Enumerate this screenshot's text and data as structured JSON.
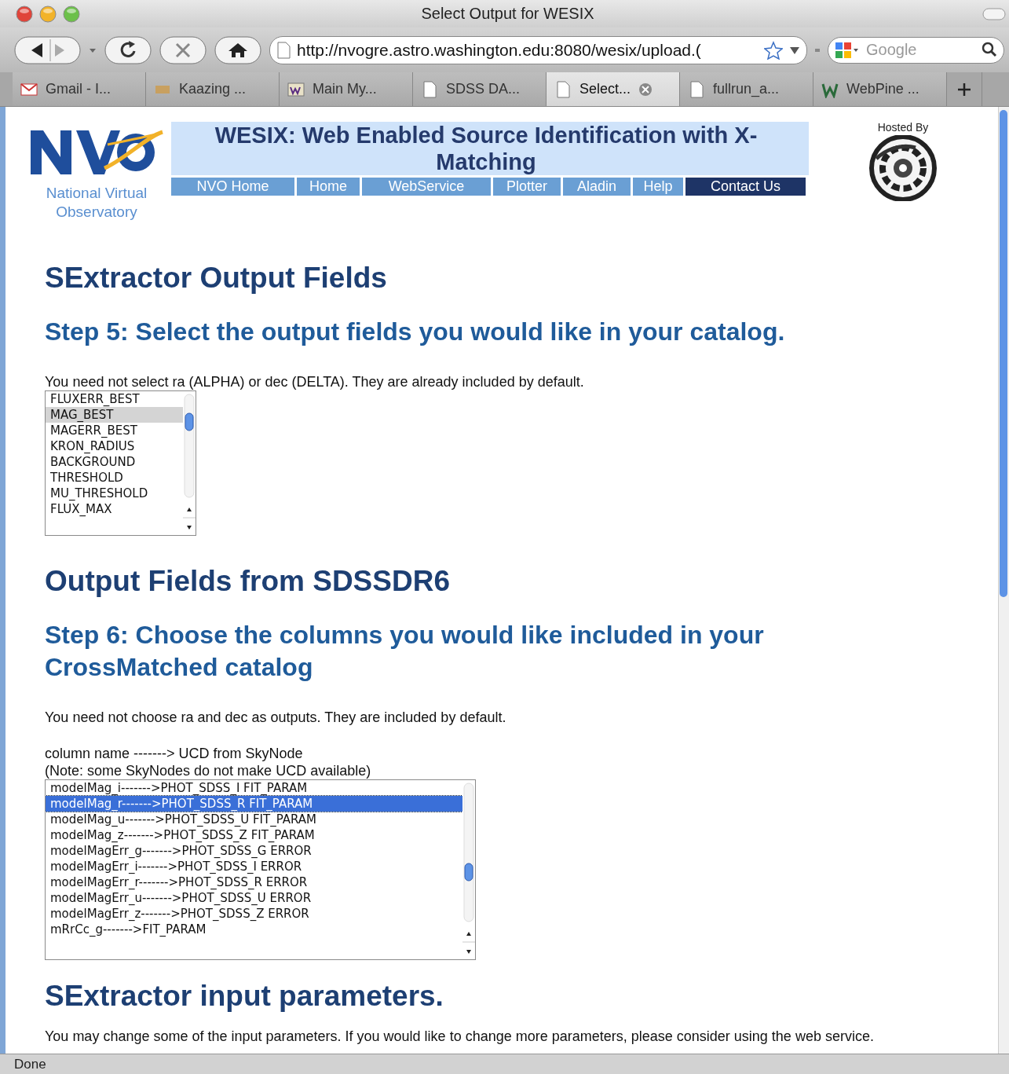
{
  "window": {
    "title": "Select Output for WESIX"
  },
  "toolbar": {
    "url": "http://nvogre.astro.washington.edu:8080/wesix/upload.(",
    "search": {
      "placeholder": "Google"
    }
  },
  "tabs": [
    {
      "label": "Gmail - I...",
      "selected": false,
      "kind": "mail"
    },
    {
      "label": "Kaazing ...",
      "selected": false,
      "kind": "site"
    },
    {
      "label": "Main My...",
      "selected": false,
      "kind": "uw"
    },
    {
      "label": "SDSS DA...",
      "selected": false,
      "kind": "page"
    },
    {
      "label": "Select...",
      "selected": true,
      "kind": "page"
    },
    {
      "label": "fullrun_a...",
      "selected": false,
      "kind": "page"
    },
    {
      "label": "WebPine ...",
      "selected": false,
      "kind": "w"
    }
  ],
  "header": {
    "logo_caption": "National Virtual Observatory",
    "title": "WESIX: Web Enabled Source Identification with X-Matching",
    "nav": [
      {
        "label": "NVO Home",
        "selected": false
      },
      {
        "label": "Home",
        "selected": false
      },
      {
        "label": "WebService",
        "selected": false
      },
      {
        "label": "Plotter",
        "selected": false
      },
      {
        "label": "Aladin",
        "selected": false
      },
      {
        "label": "Help",
        "selected": false
      },
      {
        "label": "Contact Us",
        "selected": true
      }
    ],
    "hosted_by": "Hosted By"
  },
  "content": [
    {
      "kind": "heading",
      "text": "SExtractor Output Fields"
    },
    {
      "kind": "step",
      "text": "Step 5: Select the output fields you would like in your catalog."
    },
    {
      "kind": "text",
      "text": "You need not select ra (ALPHA) or dec (DELTA). They are already included by default."
    },
    {
      "kind": "listbox",
      "focused": false,
      "options": [
        {
          "label": "FLUXERR_BEST",
          "selected": false
        },
        {
          "label": "MAG_BEST",
          "selected": true
        },
        {
          "label": "MAGERR_BEST",
          "selected": false
        },
        {
          "label": "KRON_RADIUS",
          "selected": false
        },
        {
          "label": "BACKGROUND",
          "selected": false
        },
        {
          "label": "THRESHOLD",
          "selected": false
        },
        {
          "label": "MU_THRESHOLD",
          "selected": false
        },
        {
          "label": "FLUX_MAX",
          "selected": false
        }
      ]
    },
    {
      "kind": "heading",
      "text": "Output Fields from SDSSDR6"
    },
    {
      "kind": "step",
      "text": "Step 6: Choose the columns you would like included in your CrossMatched catalog"
    },
    {
      "kind": "text",
      "text": "You need not choose ra and dec as outputs. They are included by default."
    },
    {
      "kind": "text",
      "text": "column name -------> UCD from SkyNode"
    },
    {
      "kind": "text",
      "text": "(Note: some SkyNodes do not make UCD available)"
    },
    {
      "kind": "listbox",
      "focused": true,
      "options": [
        {
          "label": "modelMag_i------->PHOT_SDSS_I FIT_PARAM",
          "selected": false
        },
        {
          "label": "modelMag_r------->PHOT_SDSS_R FIT_PARAM",
          "selected": true
        },
        {
          "label": "modelMag_u------->PHOT_SDSS_U FIT_PARAM",
          "selected": false
        },
        {
          "label": "modelMag_z------->PHOT_SDSS_Z FIT_PARAM",
          "selected": false
        },
        {
          "label": "modelMagErr_g------->PHOT_SDSS_G ERROR",
          "selected": false
        },
        {
          "label": "modelMagErr_i------->PHOT_SDSS_I ERROR",
          "selected": false
        },
        {
          "label": "modelMagErr_r------->PHOT_SDSS_R ERROR",
          "selected": false
        },
        {
          "label": "modelMagErr_u------->PHOT_SDSS_U ERROR",
          "selected": false
        },
        {
          "label": "modelMagErr_z------->PHOT_SDSS_Z ERROR",
          "selected": false
        },
        {
          "label": "mRrCc_g------->FIT_PARAM",
          "selected": false
        }
      ]
    },
    {
      "kind": "heading",
      "text": "SExtractor input parameters."
    },
    {
      "kind": "text",
      "text": "You may change some of the input parameters. If you would like to change more parameters, please consider using the web service."
    }
  ],
  "status_bar": {
    "text": "Done"
  }
}
